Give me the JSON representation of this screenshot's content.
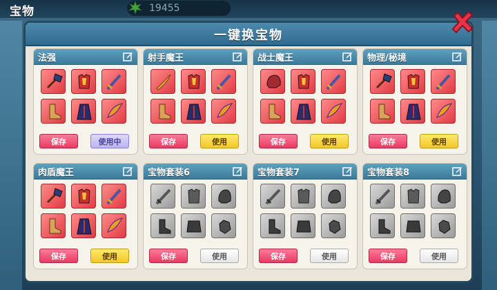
{
  "top_bar": {
    "page_title": "宝物",
    "currency_value": "19455"
  },
  "modal": {
    "title": "一键换宝物"
  },
  "colors": {
    "header": "#3b7a9a",
    "save": "#e73b63",
    "use_yellow": "#f2c72a",
    "using": "#b9b4ef",
    "slot_red": "#e03c44",
    "slot_gray": "#9b9b9b"
  },
  "presets": [
    {
      "name": "法强",
      "save_label": "保存",
      "use_label": "使用中",
      "use_state": "active",
      "slot_style": "red",
      "items": [
        "axe-icon",
        "armor-icon",
        "sword-icon",
        "boot-icon",
        "robe-icon",
        "wing-icon"
      ]
    },
    {
      "name": "射手魔王",
      "save_label": "保存",
      "use_label": "使用",
      "use_state": "yellow",
      "slot_style": "red",
      "items": [
        "blade-icon",
        "armor-icon",
        "sword-icon",
        "boot-icon",
        "robe-icon",
        "wing-icon"
      ]
    },
    {
      "name": "战士魔王",
      "save_label": "保存",
      "use_label": "使用",
      "use_state": "yellow",
      "slot_style": "red",
      "items": [
        "helm-icon",
        "armor-icon",
        "sword-icon",
        "boot-icon",
        "robe-icon",
        "wing-icon"
      ]
    },
    {
      "name": "物理/秘境",
      "save_label": "保存",
      "use_label": "使用",
      "use_state": "yellow",
      "slot_style": "red",
      "items": [
        "axe-icon",
        "armor-icon",
        "sword-icon",
        "boot-icon",
        "robe-icon",
        "wing-icon"
      ]
    },
    {
      "name": "肉盾魔王",
      "save_label": "保存",
      "use_label": "使用",
      "use_state": "yellow",
      "slot_style": "red",
      "items": [
        "axe-icon",
        "armor-icon",
        "sword-icon",
        "boot-icon",
        "robe-icon",
        "wing-icon"
      ]
    },
    {
      "name": "宝物套装6",
      "save_label": "保存",
      "use_label": "使用",
      "use_state": "white",
      "slot_style": "gray",
      "items": [
        "sword-icon",
        "armor-icon",
        "helm-icon",
        "boot-icon",
        "robe-icon",
        "glove-icon"
      ]
    },
    {
      "name": "宝物套装7",
      "save_label": "保存",
      "use_label": "使用",
      "use_state": "white",
      "slot_style": "gray",
      "items": [
        "sword-icon",
        "armor-icon",
        "helm-icon",
        "boot-icon",
        "robe-icon",
        "glove-icon"
      ]
    },
    {
      "name": "宝物套装8",
      "save_label": "保存",
      "use_label": "使用",
      "use_state": "white",
      "slot_style": "gray",
      "items": [
        "sword-icon",
        "armor-icon",
        "helm-icon",
        "boot-icon",
        "robe-icon",
        "glove-icon"
      ]
    }
  ]
}
